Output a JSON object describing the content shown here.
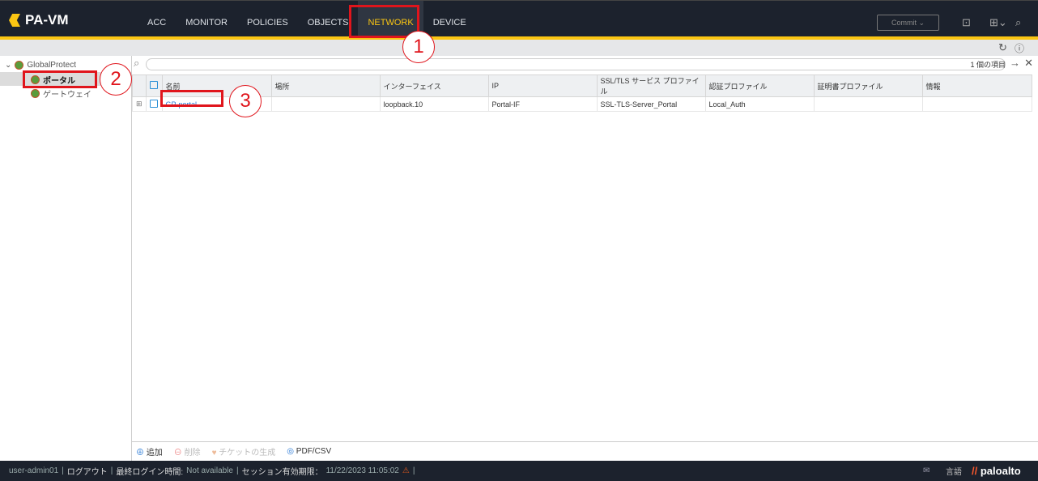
{
  "app": {
    "title": "PA-VM"
  },
  "nav": [
    {
      "label": "ACC"
    },
    {
      "label": "MONITOR"
    },
    {
      "label": "POLICIES"
    },
    {
      "label": "OBJECTS"
    },
    {
      "label": "NETWORK"
    },
    {
      "label": "DEVICE"
    }
  ],
  "header": {
    "commit": "Commit ⌄"
  },
  "annotations": [
    "1",
    "2",
    "3"
  ],
  "sidebar": {
    "root": "GlobalProtect",
    "items": [
      {
        "label": "ポータル"
      },
      {
        "label": "ゲートウェイ"
      }
    ]
  },
  "search": {
    "count": "1 個の項目"
  },
  "table": {
    "headers": [
      "名前",
      "場所",
      "インターフェイス",
      "IP",
      "SSL/TLS サービス プロファイル",
      "認証プロファイル",
      "証明書プロファイル",
      "情報"
    ],
    "rows": [
      [
        "GP-portal",
        "",
        "loopback.10",
        "Portal-IF",
        "SSL-TLS-Server_Portal",
        "Local_Auth",
        "",
        ""
      ]
    ]
  },
  "toolbar": {
    "add": "追加",
    "delete": "削除",
    "ticket": "チケットの生成",
    "pdf": "PDF/CSV"
  },
  "footer": {
    "user": "user-admin01",
    "logout": "ログアウト",
    "last_login_label": "最終ログイン時間:",
    "last_login": "Not available",
    "session_label": "セッション有効期限：",
    "session": "11/22/2023 11:05:02",
    "lang": "言語",
    "brand": "paloalto"
  }
}
